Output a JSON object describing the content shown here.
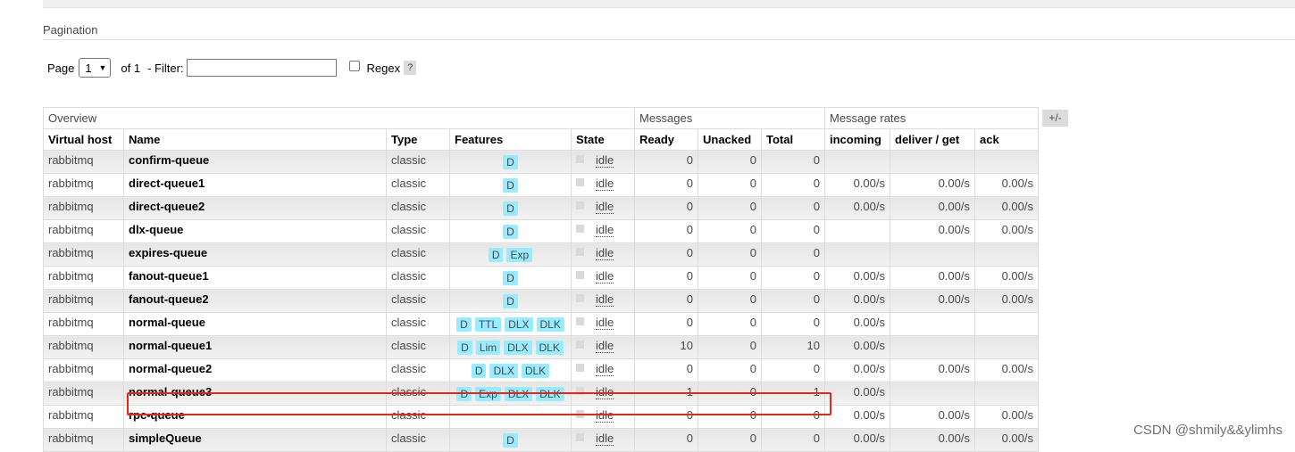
{
  "pagination": {
    "title": "Pagination",
    "page_label": "Page",
    "page_value": "1",
    "of_label": "of 1",
    "filter_label": "- Filter:",
    "filter_value": "",
    "regex_label": "Regex",
    "help_label": "?"
  },
  "table": {
    "groups": {
      "overview": "Overview",
      "messages": "Messages",
      "rates": "Message rates"
    },
    "columns": [
      "Virtual host",
      "Name",
      "Type",
      "Features",
      "State",
      "Ready",
      "Unacked",
      "Total",
      "incoming",
      "deliver / get",
      "ack"
    ],
    "plus_minus": "+/-",
    "rows": [
      {
        "vhost": "rabbitmq",
        "name": "confirm-queue",
        "type": "classic",
        "features": [
          "D"
        ],
        "state": "idle",
        "ready": "0",
        "unacked": "0",
        "total": "0",
        "incoming": "",
        "deliver": "",
        "ack": ""
      },
      {
        "vhost": "rabbitmq",
        "name": "direct-queue1",
        "type": "classic",
        "features": [
          "D"
        ],
        "state": "idle",
        "ready": "0",
        "unacked": "0",
        "total": "0",
        "incoming": "0.00/s",
        "deliver": "0.00/s",
        "ack": "0.00/s"
      },
      {
        "vhost": "rabbitmq",
        "name": "direct-queue2",
        "type": "classic",
        "features": [
          "D"
        ],
        "state": "idle",
        "ready": "0",
        "unacked": "0",
        "total": "0",
        "incoming": "0.00/s",
        "deliver": "0.00/s",
        "ack": "0.00/s"
      },
      {
        "vhost": "rabbitmq",
        "name": "dlx-queue",
        "type": "classic",
        "features": [
          "D"
        ],
        "state": "idle",
        "ready": "0",
        "unacked": "0",
        "total": "0",
        "incoming": "",
        "deliver": "0.00/s",
        "ack": "0.00/s"
      },
      {
        "vhost": "rabbitmq",
        "name": "expires-queue",
        "type": "classic",
        "features": [
          "D",
          "Exp"
        ],
        "state": "idle",
        "ready": "0",
        "unacked": "0",
        "total": "0",
        "incoming": "",
        "deliver": "",
        "ack": ""
      },
      {
        "vhost": "rabbitmq",
        "name": "fanout-queue1",
        "type": "classic",
        "features": [
          "D"
        ],
        "state": "idle",
        "ready": "0",
        "unacked": "0",
        "total": "0",
        "incoming": "0.00/s",
        "deliver": "0.00/s",
        "ack": "0.00/s"
      },
      {
        "vhost": "rabbitmq",
        "name": "fanout-queue2",
        "type": "classic",
        "features": [
          "D"
        ],
        "state": "idle",
        "ready": "0",
        "unacked": "0",
        "total": "0",
        "incoming": "0.00/s",
        "deliver": "0.00/s",
        "ack": "0.00/s"
      },
      {
        "vhost": "rabbitmq",
        "name": "normal-queue",
        "type": "classic",
        "features": [
          "D",
          "TTL",
          "DLX",
          "DLK"
        ],
        "state": "idle",
        "ready": "0",
        "unacked": "0",
        "total": "0",
        "incoming": "0.00/s",
        "deliver": "",
        "ack": ""
      },
      {
        "vhost": "rabbitmq",
        "name": "normal-queue1",
        "type": "classic",
        "features": [
          "D",
          "Lim",
          "DLX",
          "DLK"
        ],
        "state": "idle",
        "ready": "10",
        "unacked": "0",
        "total": "10",
        "incoming": "0.00/s",
        "deliver": "",
        "ack": ""
      },
      {
        "vhost": "rabbitmq",
        "name": "normal-queue2",
        "type": "classic",
        "features": [
          "D",
          "DLX",
          "DLK"
        ],
        "state": "idle",
        "ready": "0",
        "unacked": "0",
        "total": "0",
        "incoming": "0.00/s",
        "deliver": "0.00/s",
        "ack": "0.00/s"
      },
      {
        "vhost": "rabbitmq",
        "name": "normal-queue3",
        "type": "classic",
        "features": [
          "D",
          "Exp",
          "DLX",
          "DLK"
        ],
        "state": "idle",
        "ready": "1",
        "unacked": "0",
        "total": "1",
        "incoming": "0.00/s",
        "deliver": "",
        "ack": ""
      },
      {
        "vhost": "rabbitmq",
        "name": "rpc-queue",
        "type": "classic",
        "features": [],
        "state": "idle",
        "ready": "0",
        "unacked": "0",
        "total": "0",
        "incoming": "0.00/s",
        "deliver": "0.00/s",
        "ack": "0.00/s"
      },
      {
        "vhost": "rabbitmq",
        "name": "simpleQueue",
        "type": "classic",
        "features": [
          "D"
        ],
        "state": "idle",
        "ready": "0",
        "unacked": "0",
        "total": "0",
        "incoming": "0.00/s",
        "deliver": "0.00/s",
        "ack": "0.00/s"
      }
    ]
  },
  "watermark": "CSDN @shmily&&ylimhs",
  "colors": {
    "badge": "#99ebff",
    "highlight": "#e3271f"
  }
}
